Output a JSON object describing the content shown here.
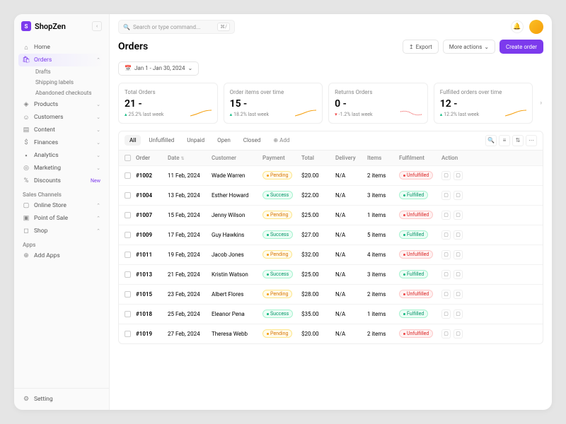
{
  "brand": {
    "name": "ShopZen",
    "initial": "S"
  },
  "search": {
    "placeholder": "Search or type command...",
    "kbd": "⌘/"
  },
  "nav": {
    "home": "Home",
    "orders": "Orders",
    "drafts": "Drafts",
    "shipping": "Shipping labels",
    "abandoned": "Abandoned checkouts",
    "products": "Products",
    "customers": "Customers",
    "content": "Content",
    "finances": "Finances",
    "analytics": "Analytics",
    "marketing": "Marketing",
    "discounts": "Discounts",
    "new_badge": "New",
    "section_sales": "Sales Channels",
    "online_store": "Online Store",
    "pos": "Point of Sale",
    "shop": "Shop",
    "section_apps": "Apps",
    "add_apps": "Add Apps",
    "setting": "Setting"
  },
  "page": {
    "title": "Orders"
  },
  "actions": {
    "export": "Export",
    "more": "More actions",
    "create": "Create order"
  },
  "date_range": "Jan 1 - Jan 30, 2024",
  "stats": [
    {
      "label": "Total Orders",
      "value": "21 -",
      "change": "25.2% last week",
      "dir": "up"
    },
    {
      "label": "Order items over time",
      "value": "15 -",
      "change": "18.2% last week",
      "dir": "up"
    },
    {
      "label": "Returns Orders",
      "value": "0 -",
      "change": "-1.2% last week",
      "dir": "down"
    },
    {
      "label": "Fulfilled orders over time",
      "value": "12 -",
      "change": "12.2% last week",
      "dir": "up"
    }
  ],
  "tabs": {
    "all": "All",
    "unfulfilled": "Unfulfilled",
    "unpaid": "Unpaid",
    "open": "Open",
    "closed": "Closed",
    "add": "Add"
  },
  "columns": {
    "order": "Order",
    "date": "Date",
    "customer": "Customer",
    "payment": "Payment",
    "total": "Total",
    "delivery": "Delivery",
    "items": "Items",
    "fulfilment": "Fulfilment",
    "action": "Action"
  },
  "payment_labels": {
    "pending": "Pending",
    "success": "Success"
  },
  "fulfilment_labels": {
    "fulfilled": "Fulfilled",
    "unfulfilled": "Unfulfilled"
  },
  "rows": [
    {
      "id": "#1002",
      "date": "11 Feb, 2024",
      "customer": "Wade Warren",
      "payment": "pending",
      "total": "$20.00",
      "delivery": "N/A",
      "items": "2 items",
      "fulfilment": "unfulfilled"
    },
    {
      "id": "#1004",
      "date": "13 Feb, 2024",
      "customer": "Esther Howard",
      "payment": "success",
      "total": "$22.00",
      "delivery": "N/A",
      "items": "3 items",
      "fulfilment": "fulfilled"
    },
    {
      "id": "#1007",
      "date": "15 Feb, 2024",
      "customer": "Jenny Wilson",
      "payment": "pending",
      "total": "$25.00",
      "delivery": "N/A",
      "items": "1 items",
      "fulfilment": "unfulfilled"
    },
    {
      "id": "#1009",
      "date": "17 Feb, 2024",
      "customer": "Guy Hawkins",
      "payment": "success",
      "total": "$27.00",
      "delivery": "N/A",
      "items": "5 items",
      "fulfilment": "fulfilled"
    },
    {
      "id": "#1011",
      "date": "19 Feb, 2024",
      "customer": "Jacob Jones",
      "payment": "pending",
      "total": "$32.00",
      "delivery": "N/A",
      "items": "4 items",
      "fulfilment": "unfulfilled"
    },
    {
      "id": "#1013",
      "date": "21 Feb, 2024",
      "customer": "Kristin Watson",
      "payment": "success",
      "total": "$25.00",
      "delivery": "N/A",
      "items": "3 items",
      "fulfilment": "fulfilled"
    },
    {
      "id": "#1015",
      "date": "23 Feb, 2024",
      "customer": "Albert Flores",
      "payment": "pending",
      "total": "$28.00",
      "delivery": "N/A",
      "items": "2 items",
      "fulfilment": "unfulfilled"
    },
    {
      "id": "#1018",
      "date": "25 Feb, 2024",
      "customer": "Eleanor Pena",
      "payment": "success",
      "total": "$35.00",
      "delivery": "N/A",
      "items": "1 items",
      "fulfilment": "fulfilled"
    },
    {
      "id": "#1019",
      "date": "27 Feb, 2024",
      "customer": "Theresa Webb",
      "payment": "pending",
      "total": "$20.00",
      "delivery": "N/A",
      "items": "2 items",
      "fulfilment": "unfulfilled"
    }
  ]
}
